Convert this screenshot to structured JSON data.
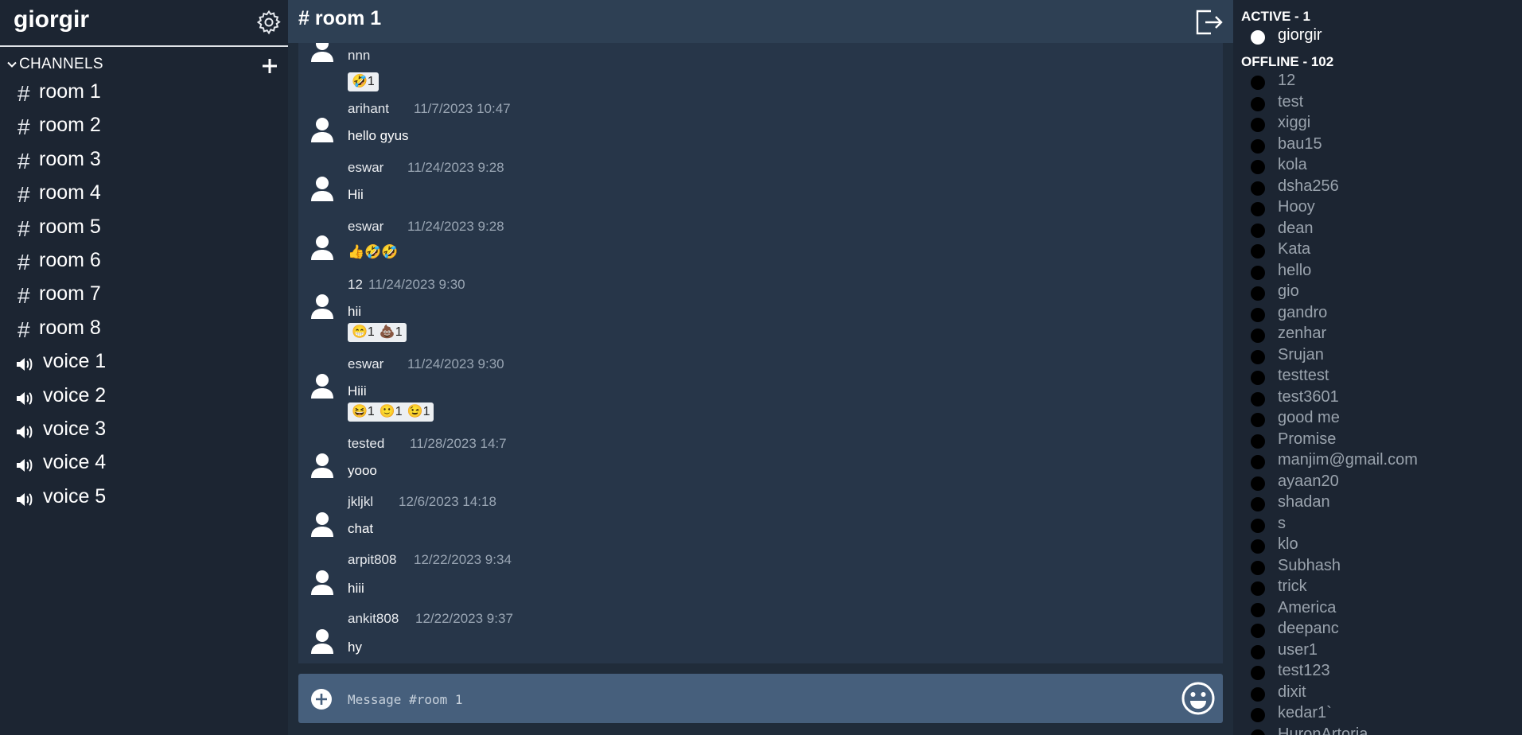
{
  "user": {
    "name": "giorgir"
  },
  "channels": {
    "header": "CHANNELS",
    "text": [
      {
        "name": "room 1"
      },
      {
        "name": "room 2"
      },
      {
        "name": "room 3"
      },
      {
        "name": "room 4"
      },
      {
        "name": "room 5"
      },
      {
        "name": "room 6"
      },
      {
        "name": "room 7"
      },
      {
        "name": "room 8"
      }
    ],
    "voice": [
      {
        "name": "voice 1"
      },
      {
        "name": "voice 2"
      },
      {
        "name": "voice 3"
      },
      {
        "name": "voice 4"
      },
      {
        "name": "voice 5"
      }
    ],
    "hash_symbol": "#"
  },
  "room": {
    "title": "# room 1"
  },
  "messages": [
    {
      "author": "nnn",
      "time": "",
      "text": "",
      "reactions": [
        {
          "emoji": "🤣",
          "count": "1"
        }
      ]
    },
    {
      "author": "arihant",
      "time": "11/7/2023 10:47",
      "text": "hello gyus",
      "reactions": []
    },
    {
      "author": "eswar",
      "time": "11/24/2023 9:28",
      "text": "Hii",
      "reactions": []
    },
    {
      "author": "eswar",
      "time": "11/24/2023 9:28",
      "text": "👍🤣🤣",
      "reactions": []
    },
    {
      "author": "12",
      "time": "11/24/2023 9:30",
      "text": "hii",
      "reactions": [
        {
          "emoji": "😁",
          "count": "1"
        },
        {
          "emoji": "💩",
          "count": "1"
        }
      ]
    },
    {
      "author": "eswar",
      "time": "11/24/2023 9:30",
      "text": "Hiii",
      "reactions": [
        {
          "emoji": "😆",
          "count": "1"
        },
        {
          "emoji": "🙂",
          "count": "1"
        },
        {
          "emoji": "😉",
          "count": "1"
        }
      ]
    },
    {
      "author": "tested",
      "time": "11/28/2023 14:7",
      "text": "yooo",
      "reactions": []
    },
    {
      "author": "jkljkl",
      "time": "12/6/2023 14:18",
      "text": "chat",
      "reactions": []
    },
    {
      "author": "arpit808",
      "time": "12/22/2023 9:34",
      "text": "hiii",
      "reactions": []
    },
    {
      "author": "ankit808",
      "time": "12/22/2023 9:37",
      "text": "hy",
      "reactions": []
    }
  ],
  "composer": {
    "placeholder": "Message #room 1"
  },
  "members": {
    "active_title": "ACTIVE - 1",
    "active": [
      "giorgir"
    ],
    "offline_title": "OFFLINE - 102",
    "offline": [
      "12",
      "test",
      "xiggi",
      "bau15",
      "kola",
      "dsha256",
      "Hooy",
      "dean",
      "Kata",
      "hello",
      "gio",
      "gandro",
      "zenhar",
      "Srujan",
      "testtest",
      "test3601",
      "good me",
      "Promise",
      "manjim@gmail.com",
      "ayaan20",
      "shadan",
      "s",
      "klo",
      "Subhash",
      "trick",
      "America",
      "deepanc",
      "user1",
      "test123",
      "dixit",
      "kedar1`",
      "HuronArtoria"
    ]
  },
  "colors": {
    "sidebar_bg": "#1c2532",
    "main_bg": "#202c3a",
    "header_bg": "#2e4054",
    "messages_bg": "#273649",
    "composer_bg": "#465f7c",
    "offline_text": "#9aa3ad"
  },
  "icons": {
    "settings": "gear-icon",
    "add_channel": "plus-icon",
    "collapse": "chevron-down-icon",
    "voice": "speaker-icon",
    "logout": "logout-icon",
    "avatar": "user-avatar-icon",
    "attach": "plus-circle-icon",
    "emoji": "smiley-icon"
  }
}
